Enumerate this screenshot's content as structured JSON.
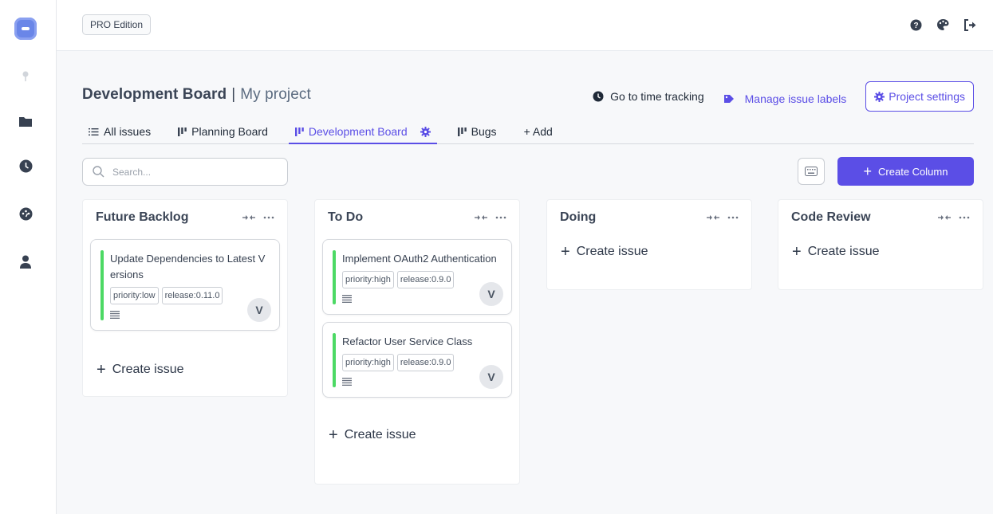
{
  "topbar": {
    "edition_badge": "PRO Edition",
    "icons": [
      "help-icon",
      "palette-icon",
      "logout-icon"
    ]
  },
  "rail": {
    "icons": [
      "app-logo",
      "pin-icon",
      "folder-icon",
      "clock-icon",
      "dashboard-icon",
      "user-icon"
    ]
  },
  "header": {
    "board_title": "Development Board",
    "separator": "|",
    "project_name": "My project",
    "time_tracking": "Go to time tracking",
    "manage_labels": "Manage issue labels",
    "project_settings": "Project settings"
  },
  "tabs": [
    {
      "label": "All issues",
      "icon": "list-icon"
    },
    {
      "label": "Planning Board",
      "icon": "board-icon"
    },
    {
      "label": "Development Board",
      "icon": "board-icon",
      "active": true
    },
    {
      "label": "Bugs",
      "icon": "board-icon"
    },
    {
      "label": "+ Add",
      "icon": ""
    }
  ],
  "toolbar": {
    "search_placeholder": "Search...",
    "create_column": "Create Column"
  },
  "columns": [
    {
      "title": "Future Backlog",
      "create_issue": "Create issue",
      "cards": [
        {
          "title": "Update Dependencies to Latest Versions",
          "labels": [
            "priority:low",
            "release:0.11.0"
          ],
          "avatar": "V"
        }
      ]
    },
    {
      "title": "To Do",
      "create_issue": "Create issue",
      "cards": [
        {
          "title": "Implement OAuth2 Authentication",
          "labels": [
            "priority:high",
            "release:0.9.0"
          ],
          "avatar": "V"
        },
        {
          "title": "Refactor User Service Class",
          "labels": [
            "priority:high",
            "release:0.9.0"
          ],
          "avatar": "V"
        }
      ]
    },
    {
      "title": "Doing",
      "create_issue": "Create issue",
      "cards": []
    },
    {
      "title": "Code Review",
      "create_issue": "Create issue",
      "cards": []
    }
  ],
  "colors": {
    "accent": "#5b4ee6",
    "card_bar": "#4cd964"
  }
}
